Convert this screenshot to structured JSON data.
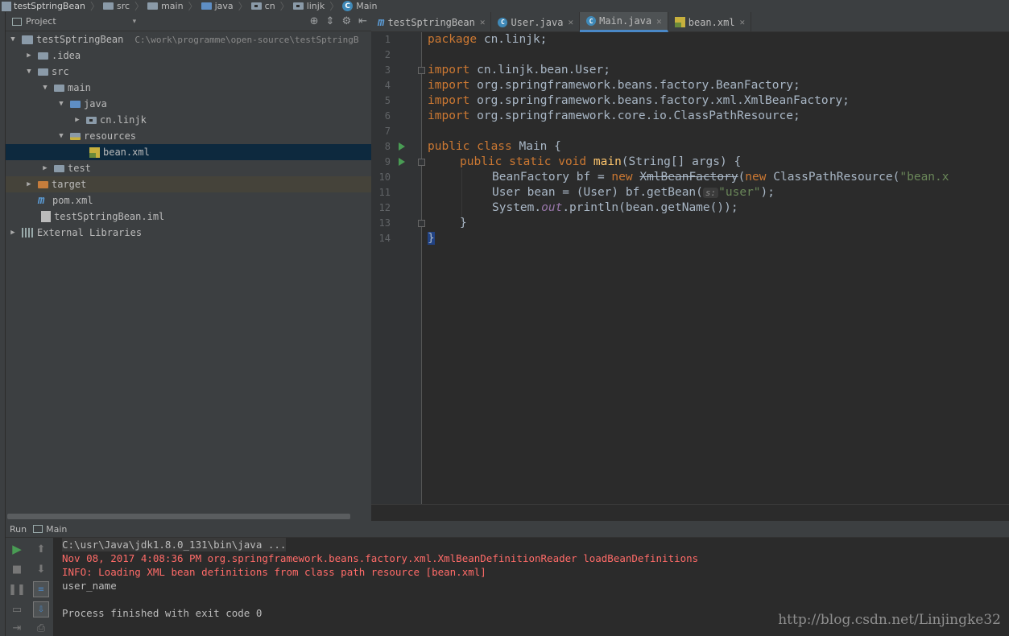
{
  "breadcrumb": {
    "items": [
      "testSptringBean",
      "src",
      "main",
      "java",
      "cn",
      "linjk",
      "Main"
    ]
  },
  "project_panel": {
    "title": "Project",
    "dropdown": "▾",
    "tree": [
      {
        "label": "testSptringBean",
        "path": "C:\\work\\programme\\open-source\\testSptringB",
        "arrow": "▼"
      },
      {
        "label": ".idea",
        "arrow": "▶"
      },
      {
        "label": "src",
        "arrow": "▼"
      },
      {
        "label": "main",
        "arrow": "▼"
      },
      {
        "label": "java",
        "arrow": "▼"
      },
      {
        "label": "cn.linjk",
        "arrow": "▶"
      },
      {
        "label": "resources",
        "arrow": "▼"
      },
      {
        "label": "bean.xml",
        "arrow": ""
      },
      {
        "label": "test",
        "arrow": "▶"
      },
      {
        "label": "target",
        "arrow": "▶"
      },
      {
        "label": "pom.xml",
        "arrow": ""
      },
      {
        "label": "testSptringBean.iml",
        "arrow": ""
      },
      {
        "label": "External Libraries",
        "arrow": "▶"
      }
    ]
  },
  "tabs": [
    {
      "label": "testSptringBean",
      "icon": "maven-m-icon",
      "active": false
    },
    {
      "label": "User.java",
      "icon": "class-c-icon",
      "active": false
    },
    {
      "label": "Main.java",
      "icon": "class-c-icon",
      "active": true
    },
    {
      "label": "bean.xml",
      "icon": "xml-file-icon",
      "active": false
    }
  ],
  "editor": {
    "line_numbers": [
      "1",
      "2",
      "3",
      "4",
      "5",
      "6",
      "7",
      "8",
      "9",
      "10",
      "11",
      "12",
      "13",
      "14"
    ],
    "code": {
      "l1_kw": "package",
      "l1_rest": " cn.linjk;",
      "l3_kw": "import",
      "l3_rest": " cn.linjk.bean.User;",
      "l4_kw": "import",
      "l4_rest": " org.springframework.beans.factory.BeanFactory;",
      "l5_kw": "import",
      "l5_rest": " org.springframework.beans.factory.xml.XmlBeanFactory;",
      "l6_kw": "import",
      "l6_rest": " org.springframework.core.io.ClassPathResource;",
      "l8_kw": "public class",
      "l8_rest": " Main {",
      "l9_kw": "public static void",
      "l9_fn": "main",
      "l9_rest": "(String[] args) {",
      "l10_a": "BeanFactory bf = ",
      "l10_kw": "new",
      "l10_strike": "XmlBeanFactory",
      "l10_b": "(",
      "l10_kw2": "new",
      "l10_c": " ClassPathResource(",
      "l10_str": "\"bean.x",
      "l11_a": "User bean = (User) bf.getBean(",
      "l11_hint": "s:",
      "l11_str": "\"user\"",
      "l11_b": ");",
      "l12_a": "System.",
      "l12_st": "out",
      "l12_b": ".println(bean.getName());",
      "l13": "}",
      "l14": "}"
    }
  },
  "run_panel": {
    "label": "Run",
    "config": "Main",
    "output": [
      {
        "text": "C:\\usr\\Java\\jdk1.8.0_131\\bin\\java ...",
        "type": "cmd"
      },
      {
        "text": "Nov 08, 2017 4:08:36 PM org.springframework.beans.factory.xml.XmlBeanDefinitionReader loadBeanDefinitions",
        "type": "err"
      },
      {
        "text": "INFO: Loading XML bean definitions from class path resource [bean.xml]",
        "type": "err"
      },
      {
        "text": "user_name",
        "type": "nrm"
      },
      {
        "text": "",
        "type": "nrm"
      },
      {
        "text": "Process finished with exit code 0",
        "type": "nrm"
      }
    ]
  },
  "watermark": "http://blog.csdn.net/Linjingke32",
  "colors": {
    "keyword": "#cc7832",
    "function": "#ffc66d",
    "string": "#6a8759",
    "static_field": "#9876aa",
    "error_output": "#ff6b68",
    "selection": "#0d293e"
  }
}
